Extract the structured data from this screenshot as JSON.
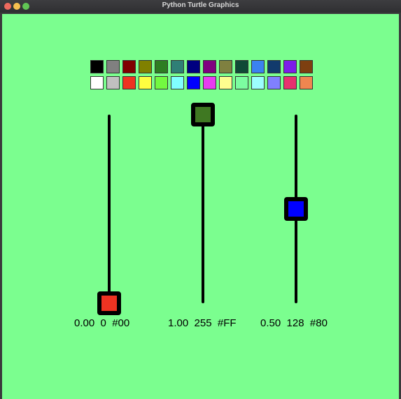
{
  "window": {
    "title": "Python Turtle Graphics"
  },
  "palette": {
    "row1": [
      "#000000",
      "#808080",
      "#800000",
      "#808000",
      "#2e7d22",
      "#2f7f76",
      "#000080",
      "#800080",
      "#7f8040",
      "#0f4a36",
      "#3b82f0",
      "#123a6c",
      "#7d1de9",
      "#7d3f10"
    ],
    "row2": [
      "#ffffff",
      "#c0c0c0",
      "#ee3322",
      "#fdfd40",
      "#73f940",
      "#80ffff",
      "#0000ff",
      "#e73cf0",
      "#fdfd8f",
      "#7cfda0",
      "#9cfefe",
      "#8080fe",
      "#e6306f",
      "#ef8650"
    ]
  },
  "sliders": [
    {
      "name": "red",
      "value": 0.0,
      "color": "#ee3322",
      "readout": "0.00  0  #00"
    },
    {
      "name": "green",
      "value": 1.0,
      "color": "#3f7822",
      "readout": "1.00  255  #FF"
    },
    {
      "name": "blue",
      "value": 0.5,
      "color": "#0000ff",
      "readout": "0.50  128  #80"
    }
  ]
}
